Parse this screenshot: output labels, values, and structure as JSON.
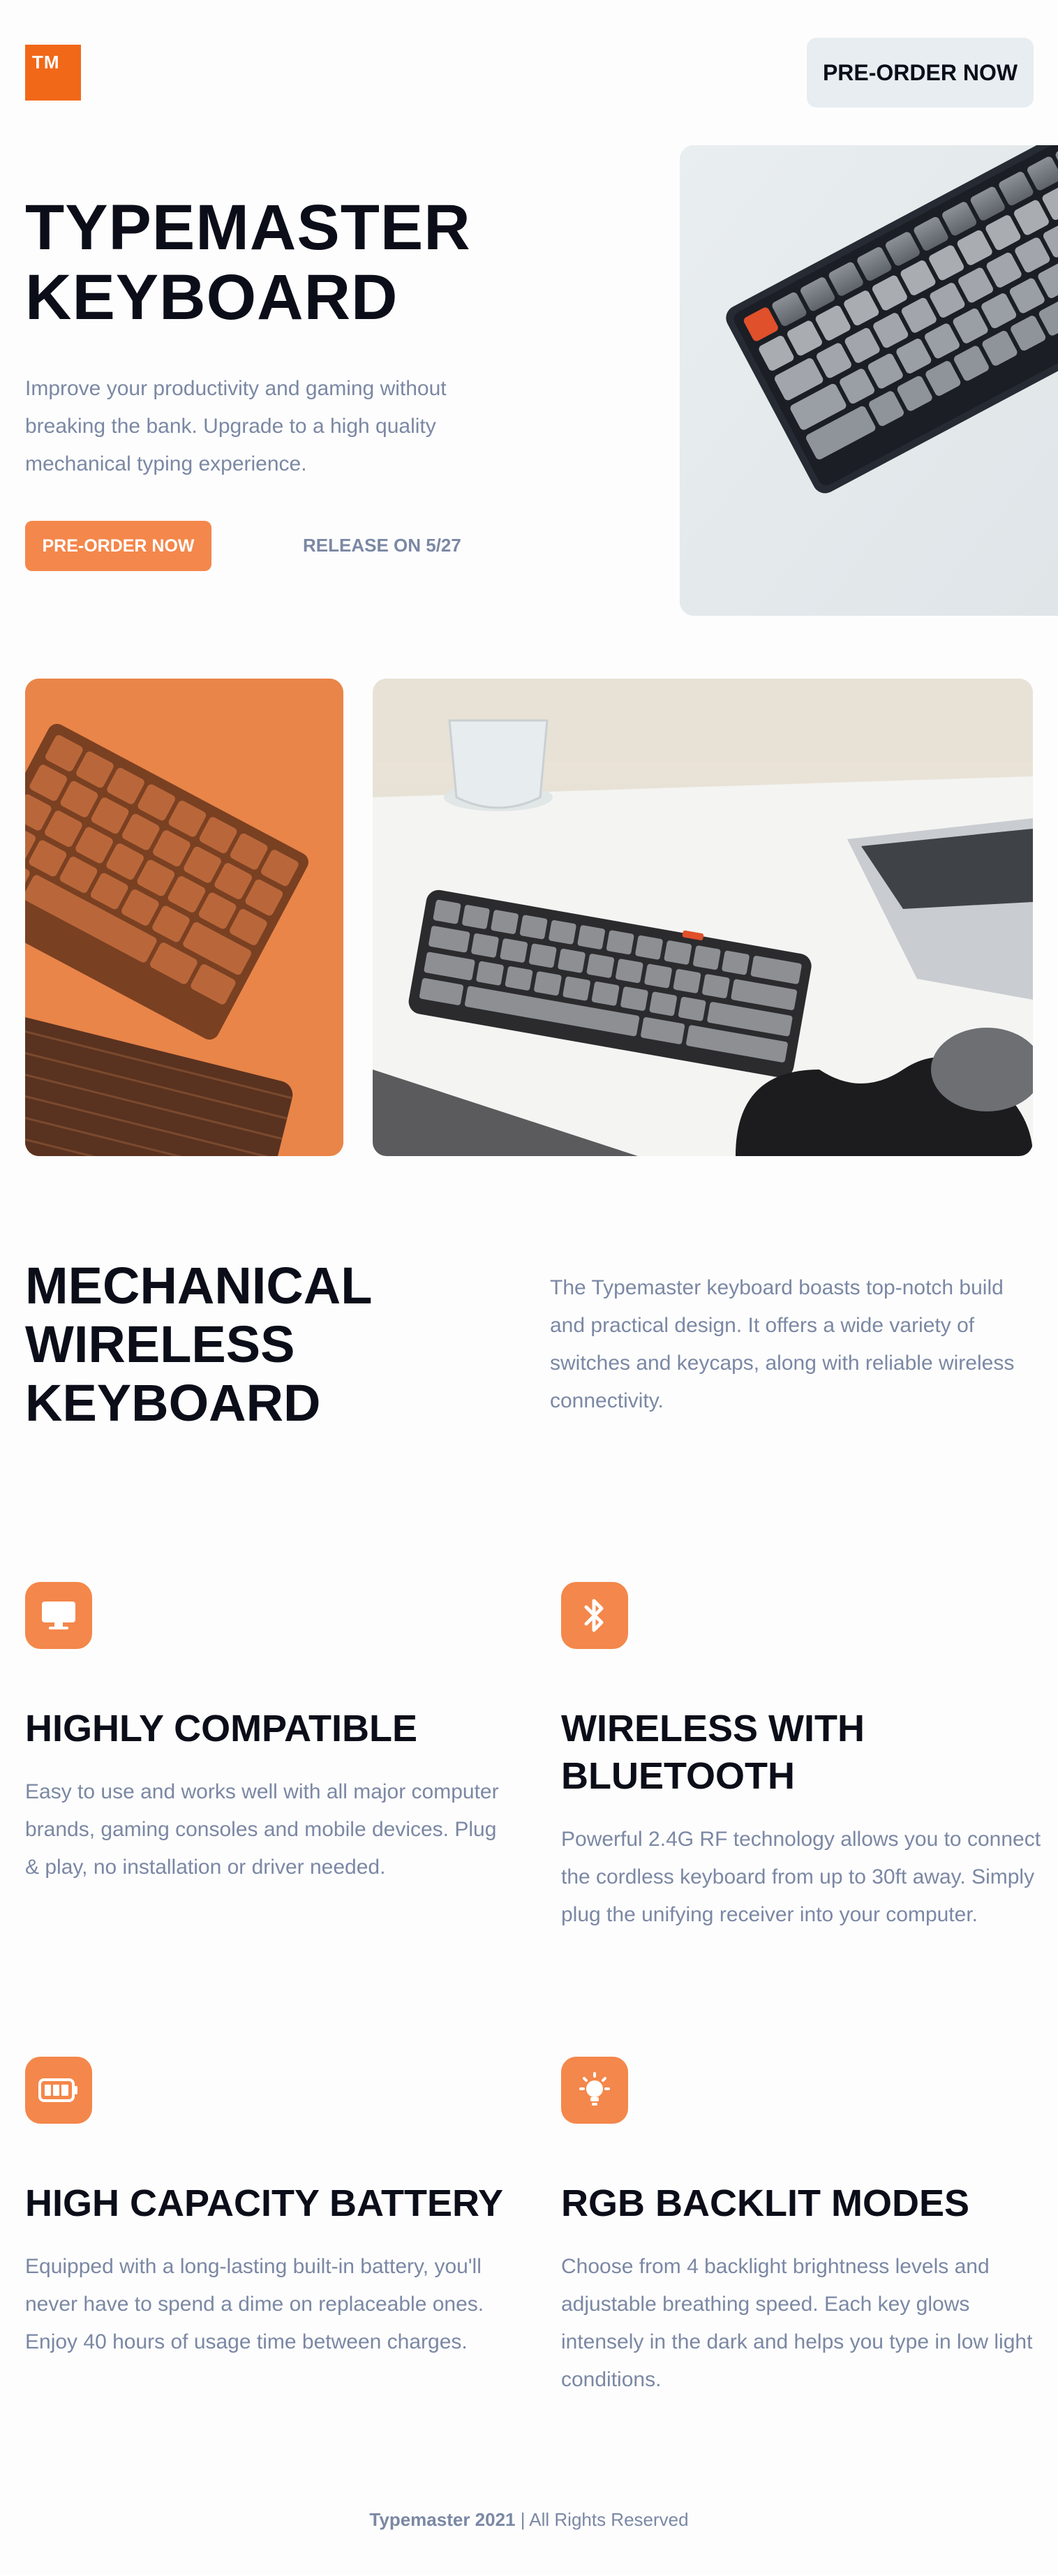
{
  "header": {
    "logo_text": "TM",
    "nav_cta": "PRE-ORDER NOW"
  },
  "hero": {
    "title_line1": "TYPEMASTER",
    "title_line2": "KEYBOARD",
    "description": "Improve your productivity and gaming without breaking the bank. Upgrade to a high quality mechanical typing experience.",
    "cta": "PRE-ORDER NOW",
    "release": "RELEASE ON 5/27"
  },
  "about": {
    "title_line1": "MECHANICAL",
    "title_line2": "WIRELESS",
    "title_line3": "KEYBOARD",
    "description": "The Typemaster keyboard boasts top-notch build and practical design. It offers a wide variety of switches and keycaps, along with reliable wireless connectivity."
  },
  "features": [
    {
      "icon": "monitor-icon",
      "title": "HIGHLY COMPATIBLE",
      "description": "Easy to use and works well with all major computer brands, gaming consoles and mobile devices. Plug & play, no installation or driver needed."
    },
    {
      "icon": "bluetooth-icon",
      "title": "WIRELESS WITH BLUETOOTH",
      "description": "Powerful 2.4G RF technology allows you to connect the cordless keyboard from up to 30ft away. Simply plug the unifying receiver into your computer."
    },
    {
      "icon": "battery-icon",
      "title": "HIGH CAPACITY BATTERY",
      "description": "Equipped with a long-lasting built-in battery, you'll never have to spend a dime on replaceable ones. Enjoy 40 hours of usage time between charges."
    },
    {
      "icon": "lightbulb-icon",
      "title": "RGB BACKLIT MODES",
      "description": "Choose from 4 backlight brightness levels and adjustable breathing speed. Each key glows intensely in the dark and helps you type in low light conditions."
    }
  ],
  "footer": {
    "brand": "Typemaster 2021",
    "rights": " | All Rights Reserved"
  },
  "colors": {
    "accent": "#f4874b",
    "logo": "#f16818",
    "text_dark": "#0b0e19",
    "text_muted": "#7b88a4",
    "nav_button_bg": "#e7edf1"
  }
}
